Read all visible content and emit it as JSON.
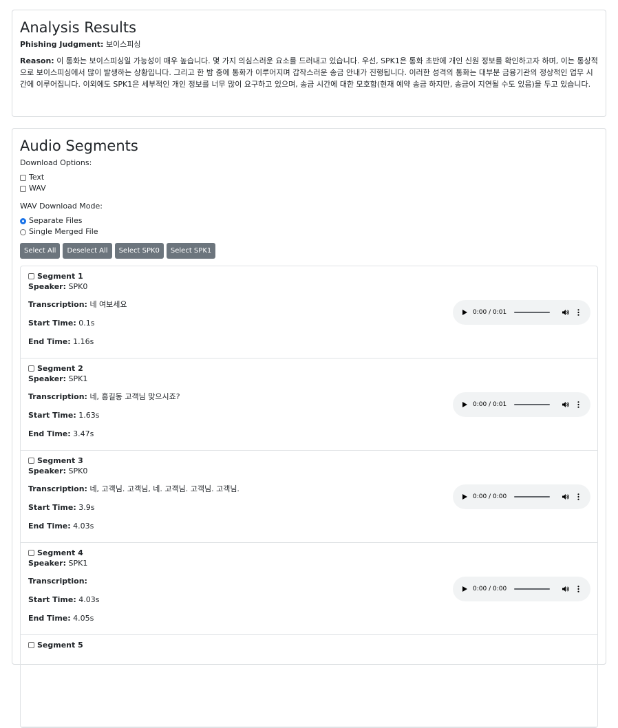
{
  "analysis": {
    "title": "Analysis Results",
    "judgment_label": "Phishing Judgment:",
    "judgment_value": "보이스피싱",
    "reason_label": "Reason:",
    "reason_text": "이 통화는 보이스피싱일 가능성이 매우 높습니다. 몇 가지 의심스러운 요소를 드러내고 있습니다. 우선, SPK1은 통화 초반에 개인 신원 정보를 확인하고자 하며, 이는 통상적으로 보이스피싱에서 많이 발생하는 상황입니다. 그리고 한 밤 중에 통화가 이루어지며 갑작스러운 송금 안내가 진행됩니다. 이러한 성격의 통화는 대부분 금융기관의 정상적인 업무 시간에 이루어집니다. 이외에도 SPK1은 세부적인 개인 정보를 너무 많이 요구하고 있으며, 송금 시간에 대한 모호함(현재 예약 송금 하지만, 송금이 지연될 수도 있음)을 두고 있습니다."
  },
  "audio": {
    "title": "Audio Segments",
    "download_options_label": "Download Options:",
    "option_text": "Text",
    "option_wav": "WAV",
    "wav_mode_label": "WAV Download Mode:",
    "mode_separate": "Separate Files",
    "mode_merged": "Single Merged File",
    "buttons": {
      "select_all": "Select All",
      "deselect_all": "Deselect All",
      "select_spk0": "Select SPK0",
      "select_spk1": "Select SPK1"
    },
    "labels": {
      "speaker": "Speaker:",
      "transcription": "Transcription:",
      "start": "Start Time:",
      "end": "End Time:"
    },
    "segments": [
      {
        "title": "Segment 1",
        "speaker": "SPK0",
        "transcription": "네 여보세요",
        "start": "0.1s",
        "end": "1.16s",
        "time": "0:00 / 0:01"
      },
      {
        "title": "Segment 2",
        "speaker": "SPK1",
        "transcription": "네, 홍길동 고객님 맞으시죠?",
        "start": "1.63s",
        "end": "3.47s",
        "time": "0:00 / 0:01"
      },
      {
        "title": "Segment 3",
        "speaker": "SPK0",
        "transcription": "네, 고객님. 고객님, 네. 고객님. 고객님. 고객님.",
        "start": "3.9s",
        "end": "4.03s",
        "time": "0:00 / 0:00"
      },
      {
        "title": "Segment 4",
        "speaker": "SPK1",
        "transcription": "",
        "start": "4.03s",
        "end": "4.05s",
        "time": "0:00 / 0:00"
      },
      {
        "title": "Segment 5",
        "speaker": "",
        "transcription": "",
        "start": "",
        "end": "",
        "time": ""
      }
    ]
  }
}
